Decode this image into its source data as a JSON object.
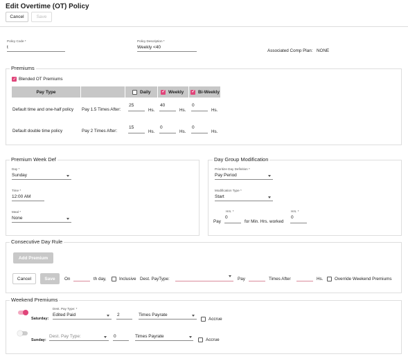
{
  "header": {
    "title": "Edit Overtime (OT) Policy",
    "cancel_label": "Cancel",
    "save_label": "Save"
  },
  "policy": {
    "code_label": "Policy Code *",
    "code_value": "t",
    "desc_label": "Policy Description *",
    "desc_value": "Weekly <40",
    "comp_plan_label": "Associated Comp Plan:",
    "comp_plan_value": "NONE"
  },
  "premiums": {
    "legend": "Premiums",
    "blended_label": "Blended OT Premiums",
    "blended_checked": true,
    "col_pay_type": "Pay Type",
    "col_daily": "Daily",
    "daily_checked": false,
    "col_weekly": "Weekly",
    "weekly_checked": true,
    "col_biweekly": "Bi-Weekly",
    "biweekly_checked": true,
    "rows": [
      {
        "pay_type": "Default time and one-half policy",
        "rule": "Pay 1.5 Times After:",
        "daily": "25",
        "weekly": "40",
        "biweekly": "0",
        "unit": "Hs."
      },
      {
        "pay_type": "Default double time policy",
        "rule": "Pay 2 Times After:",
        "daily": "15",
        "weekly": "0",
        "biweekly": "0",
        "unit": "Hs."
      }
    ]
  },
  "week_def": {
    "legend": "Premium Week Def",
    "day_label": "Day *",
    "day_value": "Sunday",
    "time_label": "Time *",
    "time_value": "12:00 AM",
    "meal_label": "Meal *",
    "meal_value": "None"
  },
  "day_group": {
    "legend": "Day Group Modification",
    "def_label": "Prioritize Day Definition *",
    "def_value": "Pay Period",
    "mod_label": "Modification Type *",
    "mod_value": "Start",
    "hrs_label": "Hrs. *",
    "pay_label": "Pay",
    "pay_value": "0",
    "min_label": "for Min. Hrs. worked",
    "min_value": "0"
  },
  "consecutive": {
    "legend": "Consecutive Day Rule",
    "add_label": "Add Premium",
    "cancel_label": "Cancel",
    "save_label": "Save",
    "on_label": "On",
    "th_day_label": "th day,",
    "inclusive_label": "Inclusive",
    "dest_label": "Dest. PayType:",
    "pay_label": "Pay",
    "times_after_label": "Times After",
    "hs_label": "Hs.",
    "override_label": "Override Weekend Premiums"
  },
  "weekend": {
    "legend": "Weekend Premiums",
    "saturday": {
      "enabled": true,
      "day_label": "Saturday:",
      "dest_label": "Dest. Pay Type: *",
      "dest_value": "Edited Paid",
      "multiplier": "2",
      "payrate_value": "Times Payrate",
      "accrue_label": "Accrue"
    },
    "sunday": {
      "enabled": false,
      "day_label": "Sunday:",
      "dest_placeholder": "Dest. Pay Type:",
      "multiplier": "0",
      "payrate_value": "Times Payrate",
      "accrue_label": "Accrue"
    }
  },
  "colors": {
    "accent": "#e0457a",
    "header_grey": "#c7c7c7",
    "border": "#dddddd"
  }
}
